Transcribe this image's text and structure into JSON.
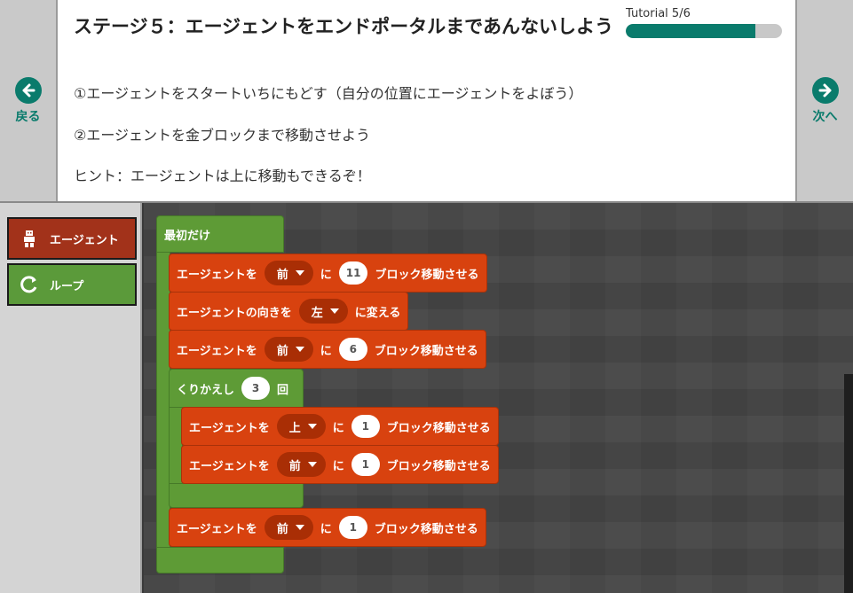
{
  "header": {
    "title": "ステージ５：エージェントをエンドポータルまであんないしよう",
    "tutorial_label": "Tutorial  5/6",
    "progress": 0.83,
    "back_label": "戻る",
    "next_label": "次へ",
    "instructions": [
      "①エージェントをスタートいちにもどす（自分の位置にエージェントをよぼう）",
      "②エージェントを金ブロックまで移動させよう",
      "ヒント：エージェントは上に移動もできるぞ！"
    ]
  },
  "toolbox": {
    "agent_label": "エージェント",
    "loop_label": "ループ"
  },
  "workspace": {
    "start_label": "最初だけ",
    "b1": {
      "prefix": "エージェントを",
      "dir": "前",
      "mid": "に",
      "count": "11",
      "suffix": "ブロック移動させる"
    },
    "b2": {
      "prefix": "エージェントの向きを",
      "dir": "左",
      "suffix": "に変える"
    },
    "b3": {
      "prefix": "エージェントを",
      "dir": "前",
      "mid": "に",
      "count": "6",
      "suffix": "ブロック移動させる"
    },
    "loop": {
      "prefix": "くりかえし",
      "count": "3",
      "suffix": "回"
    },
    "b4": {
      "prefix": "エージェントを",
      "dir": "上",
      "mid": "に",
      "count": "1",
      "suffix": "ブロック移動させる"
    },
    "b5": {
      "prefix": "エージェントを",
      "dir": "前",
      "mid": "に",
      "count": "1",
      "suffix": "ブロック移動させる"
    },
    "b6": {
      "prefix": "エージェントを",
      "dir": "前",
      "mid": "に",
      "count": "1",
      "suffix": "ブロック移動させる"
    }
  },
  "colors": {
    "teal": "#0a7b6c",
    "agent_block": "#d8420f",
    "loop_block": "#5e9b36"
  }
}
